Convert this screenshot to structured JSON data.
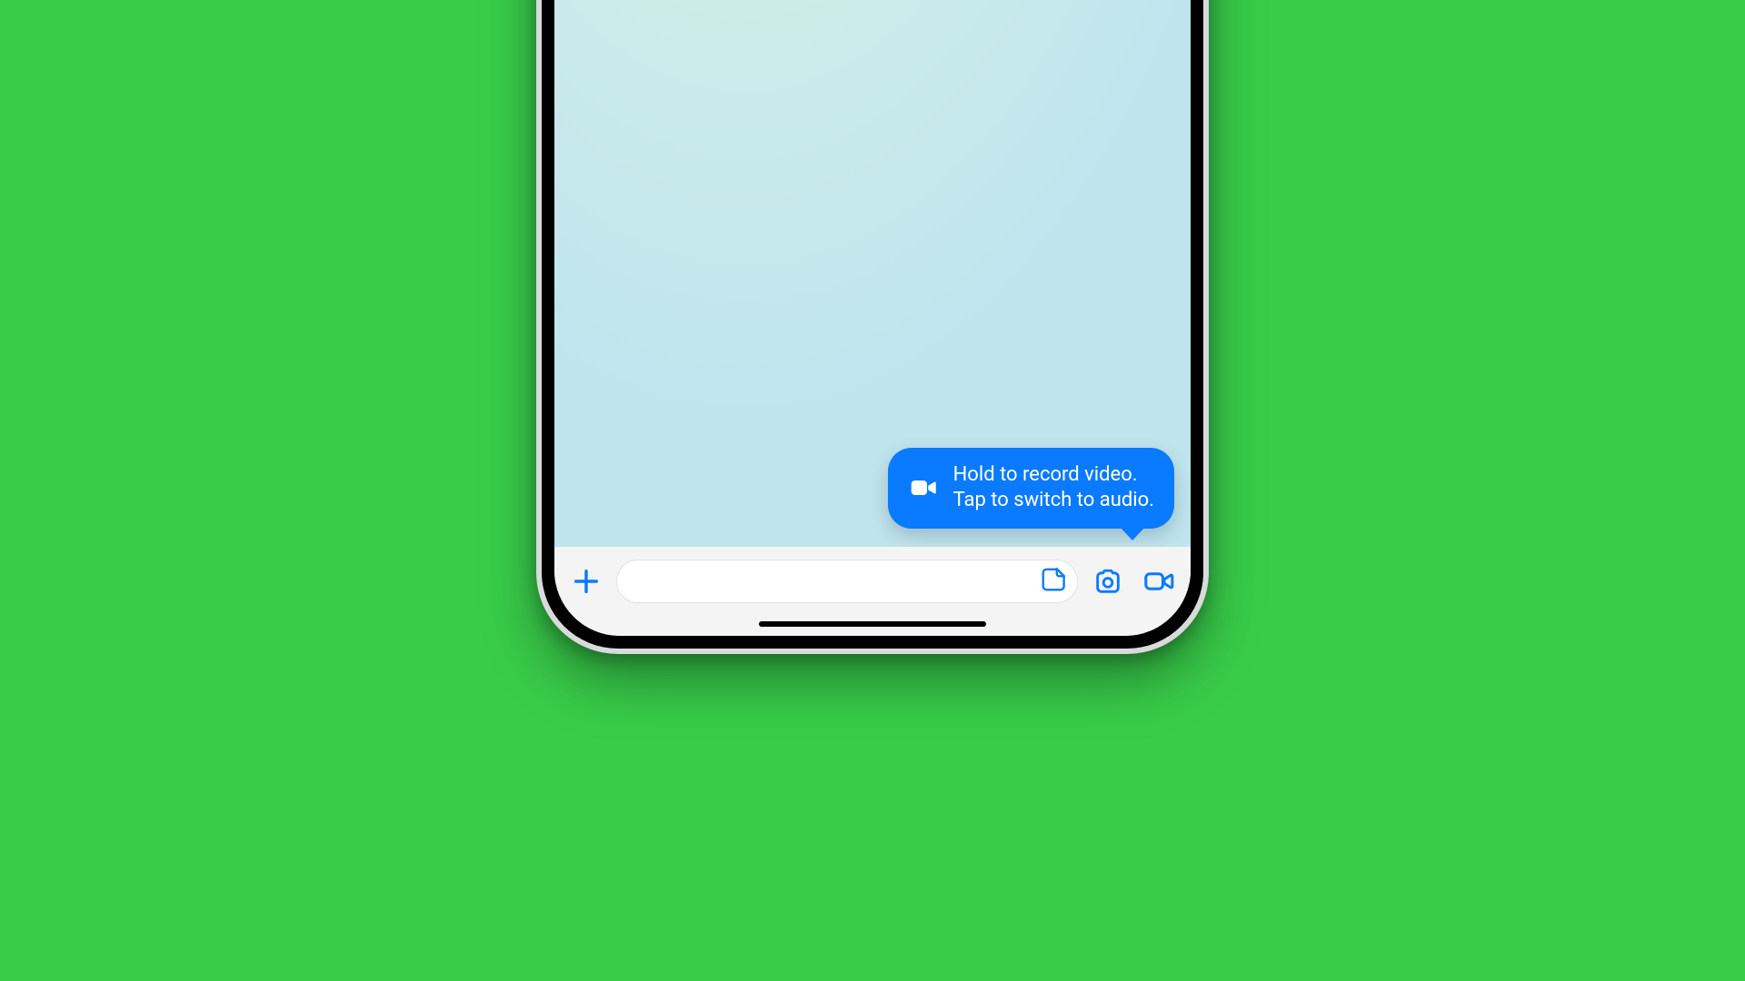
{
  "colors": {
    "page_bg": "#39cc4a",
    "accent": "#0a7aff",
    "inputbar_bg": "#f4f4f5",
    "field_bg": "#ffffff",
    "field_border": "#e2e2e4"
  },
  "tooltip": {
    "line1": "Hold to record video.",
    "line2": "Tap to switch to audio.",
    "icon": "video-icon"
  },
  "inputbar": {
    "plus_icon": "plus-icon",
    "sticker_icon": "sticker-icon",
    "camera_icon": "camera-icon",
    "video_icon": "video-icon",
    "message_placeholder": ""
  }
}
